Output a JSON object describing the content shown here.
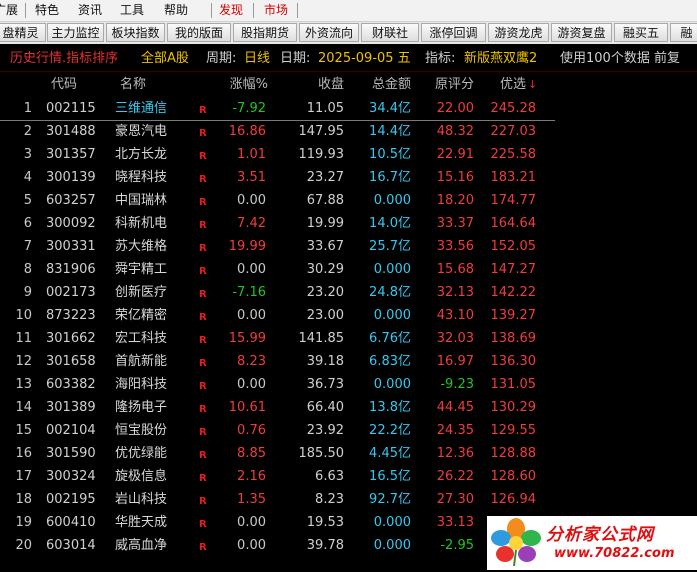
{
  "menu": {
    "items": [
      {
        "label": "广展",
        "color": "normal"
      },
      {
        "label": "特色",
        "color": "normal"
      },
      {
        "label": "资讯",
        "color": "normal"
      },
      {
        "label": "工具",
        "color": "normal"
      },
      {
        "label": "帮助",
        "color": "normal"
      },
      {
        "label": "发现",
        "color": "red"
      },
      {
        "label": "市场",
        "color": "red"
      }
    ]
  },
  "toolbar": {
    "buttons": [
      "盘精灵",
      "主力监控",
      "板块指数",
      "我的版面",
      "股指期货",
      "外资流向",
      "财联社",
      "涨停回调",
      "游资龙虎",
      "游资复盘",
      "融买五",
      "融"
    ]
  },
  "infobar": {
    "title": "历史行情.指标排序",
    "scope": "全部A股",
    "period_label": "周期:",
    "period": "日线",
    "date_label": "日期:",
    "date": "2025-09-05 五",
    "indicator_label": "指标:",
    "indicator": "新版燕双鹰2",
    "note": "使用100个数据 前复"
  },
  "table": {
    "headers": {
      "code": "代码",
      "name": "名称",
      "change": "涨幅%",
      "close": "收盘",
      "amount": "总金额",
      "score": "原评分",
      "priority": "优选",
      "sort_mark": "↓"
    },
    "rflag": "R",
    "rows": [
      {
        "idx": "1",
        "code": "002115",
        "name": "三维通信",
        "change": "-7.92",
        "close": "11.05",
        "amount": "34.4亿",
        "score": "22.00",
        "priority": "245.28",
        "chg_dir": "down",
        "score_dir": "up",
        "selected": true
      },
      {
        "idx": "2",
        "code": "301488",
        "name": "豪恩汽电",
        "change": "16.86",
        "close": "147.95",
        "amount": "14.4亿",
        "score": "48.32",
        "priority": "227.03",
        "chg_dir": "up",
        "score_dir": "up"
      },
      {
        "idx": "3",
        "code": "301357",
        "name": "北方长龙",
        "change": "1.01",
        "close": "119.93",
        "amount": "10.5亿",
        "score": "22.91",
        "priority": "225.58",
        "chg_dir": "up",
        "score_dir": "up"
      },
      {
        "idx": "4",
        "code": "300139",
        "name": "晓程科技",
        "change": "3.51",
        "close": "23.27",
        "amount": "16.7亿",
        "score": "15.16",
        "priority": "183.21",
        "chg_dir": "up",
        "score_dir": "up"
      },
      {
        "idx": "5",
        "code": "603257",
        "name": "中国瑞林",
        "change": "0.00",
        "close": "67.88",
        "amount": "0.000",
        "score": "18.20",
        "priority": "174.77",
        "chg_dir": "flat",
        "score_dir": "up"
      },
      {
        "idx": "6",
        "code": "300092",
        "name": "科新机电",
        "change": "7.42",
        "close": "19.99",
        "amount": "14.0亿",
        "score": "33.37",
        "priority": "164.64",
        "chg_dir": "up",
        "score_dir": "up"
      },
      {
        "idx": "7",
        "code": "300331",
        "name": "苏大维格",
        "change": "19.99",
        "close": "33.67",
        "amount": "25.7亿",
        "score": "33.56",
        "priority": "152.05",
        "chg_dir": "up",
        "score_dir": "up"
      },
      {
        "idx": "8",
        "code": "831906",
        "name": "舜宇精工",
        "change": "0.00",
        "close": "30.29",
        "amount": "0.000",
        "score": "15.68",
        "priority": "147.27",
        "chg_dir": "flat",
        "score_dir": "up"
      },
      {
        "idx": "9",
        "code": "002173",
        "name": "创新医疗",
        "change": "-7.16",
        "close": "23.20",
        "amount": "24.8亿",
        "score": "32.13",
        "priority": "142.22",
        "chg_dir": "down",
        "score_dir": "up"
      },
      {
        "idx": "10",
        "code": "873223",
        "name": "荣亿精密",
        "change": "0.00",
        "close": "23.00",
        "amount": "0.000",
        "score": "43.10",
        "priority": "139.27",
        "chg_dir": "flat",
        "score_dir": "up"
      },
      {
        "idx": "11",
        "code": "301662",
        "name": "宏工科技",
        "change": "15.99",
        "close": "141.85",
        "amount": "6.76亿",
        "score": "32.03",
        "priority": "138.69",
        "chg_dir": "up",
        "score_dir": "up"
      },
      {
        "idx": "12",
        "code": "301658",
        "name": "首航新能",
        "change": "8.23",
        "close": "39.18",
        "amount": "6.83亿",
        "score": "16.97",
        "priority": "136.30",
        "chg_dir": "up",
        "score_dir": "up"
      },
      {
        "idx": "13",
        "code": "603382",
        "name": "海阳科技",
        "change": "0.00",
        "close": "36.73",
        "amount": "0.000",
        "score": "-9.23",
        "priority": "131.05",
        "chg_dir": "flat",
        "score_dir": "down"
      },
      {
        "idx": "14",
        "code": "301389",
        "name": "隆扬电子",
        "change": "10.61",
        "close": "66.40",
        "amount": "13.8亿",
        "score": "44.45",
        "priority": "130.29",
        "chg_dir": "up",
        "score_dir": "up"
      },
      {
        "idx": "15",
        "code": "002104",
        "name": "恒宝股份",
        "change": "0.76",
        "close": "23.92",
        "amount": "22.2亿",
        "score": "24.35",
        "priority": "129.55",
        "chg_dir": "up",
        "score_dir": "up"
      },
      {
        "idx": "16",
        "code": "301590",
        "name": "优优绿能",
        "change": "8.85",
        "close": "185.50",
        "amount": "4.45亿",
        "score": "12.36",
        "priority": "128.88",
        "chg_dir": "up",
        "score_dir": "up"
      },
      {
        "idx": "17",
        "code": "300324",
        "name": "旋极信息",
        "change": "2.16",
        "close": "6.63",
        "amount": "16.5亿",
        "score": "26.22",
        "priority": "128.60",
        "chg_dir": "up",
        "score_dir": "up"
      },
      {
        "idx": "18",
        "code": "002195",
        "name": "岩山科技",
        "change": "1.35",
        "close": "8.23",
        "amount": "92.7亿",
        "score": "27.30",
        "priority": "126.94",
        "chg_dir": "up",
        "score_dir": "up"
      },
      {
        "idx": "19",
        "code": "600410",
        "name": "华胜天成",
        "change": "0.00",
        "close": "19.53",
        "amount": "0.000",
        "score": "33.13",
        "priority": "",
        "chg_dir": "flat",
        "score_dir": "up"
      },
      {
        "idx": "20",
        "code": "603014",
        "name": "威高血净",
        "change": "0.00",
        "close": "39.78",
        "amount": "0.000",
        "score": "-2.95",
        "priority": "",
        "chg_dir": "flat",
        "score_dir": "down"
      }
    ]
  },
  "watermark": {
    "name": "分析家公式网",
    "url": "www.70822.com",
    "colors": {
      "text": "#e01010",
      "bg": "#ffffff"
    }
  },
  "colors": {
    "up": "#ee3d3d",
    "down": "#22c522",
    "amount": "#35c8f0",
    "scope": "#f0c000",
    "accent": "#d40000"
  }
}
